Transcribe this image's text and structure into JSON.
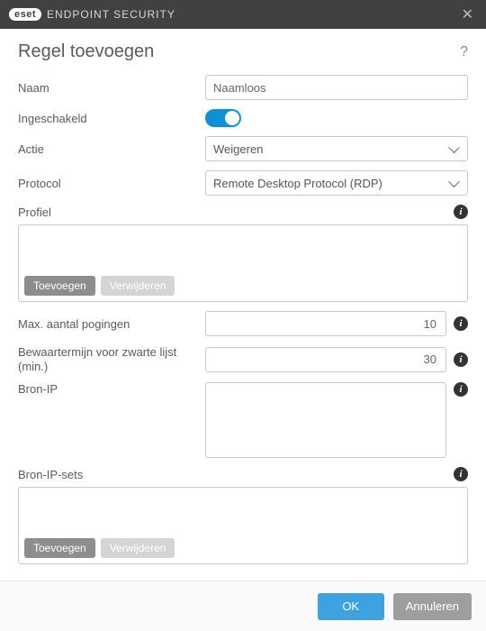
{
  "titlebar": {
    "brand_badge": "eset",
    "brand_text": "ENDPOINT SECURITY"
  },
  "heading": "Regel toevoegen",
  "labels": {
    "name": "Naam",
    "enabled": "Ingeschakeld",
    "action": "Actie",
    "protocol": "Protocol",
    "profile": "Profiel",
    "max_attempts": "Max. aantal pogingen",
    "retention": "Bewaartermijn voor zwarte lijst (min.)",
    "source_ip": "Bron-IP",
    "source_ip_sets": "Bron-IP-sets"
  },
  "values": {
    "name": "Naamloos",
    "action": "Weigeren",
    "protocol": "Remote Desktop Protocol (RDP)",
    "max_attempts": "10",
    "retention": "30"
  },
  "buttons": {
    "add": "Toevoegen",
    "remove": "Verwijderen",
    "ok": "OK",
    "cancel": "Annuleren"
  }
}
